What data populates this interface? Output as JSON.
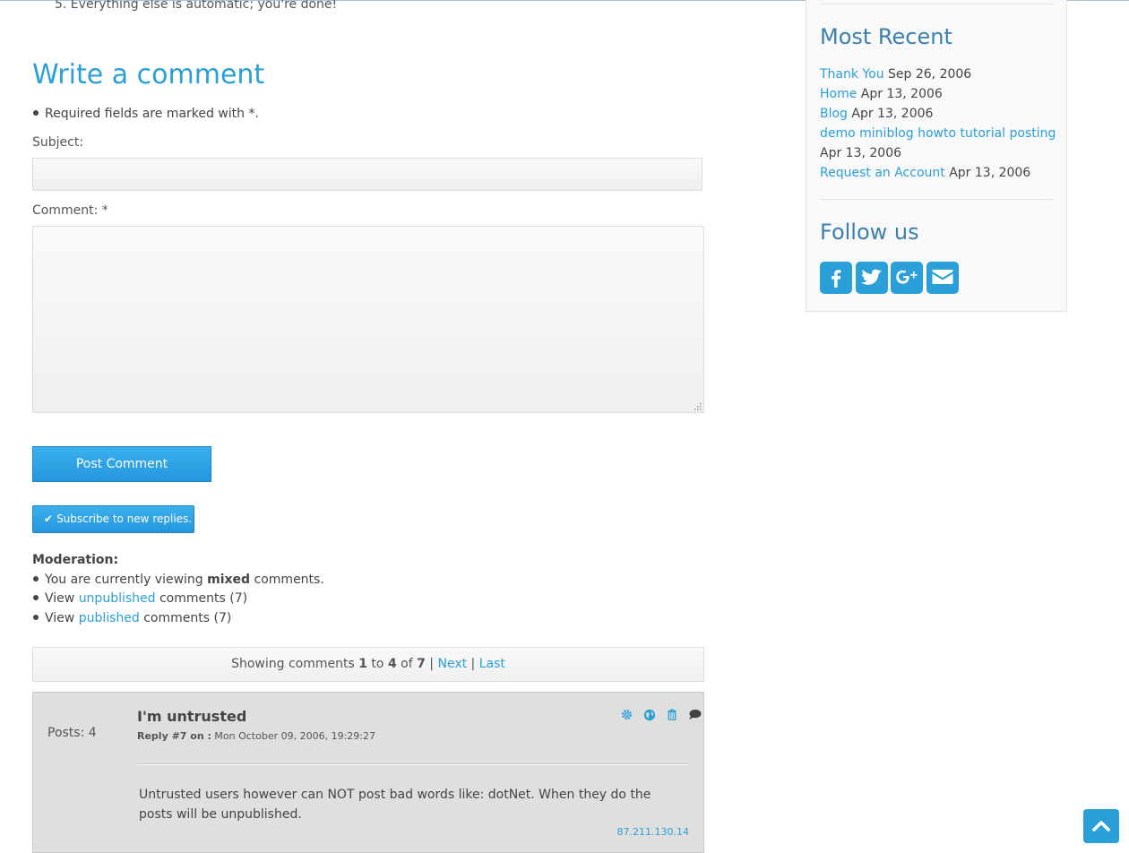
{
  "previous_step": "5. Everything else is automatic; you're done!",
  "comment_form": {
    "title": "Write a comment",
    "required_note": "Required fields are marked with *.",
    "subject_label": "Subject:",
    "subject_value": "",
    "comment_label": "Comment: *",
    "comment_value": "",
    "post_button": "Post Comment",
    "subscribe_button": "Subscribe to new replies."
  },
  "moderation": {
    "heading": "Moderation:",
    "line1_pre": "You are currently viewing ",
    "line1_bold": "mixed",
    "line1_post": " comments.",
    "line2_pre": "View ",
    "line2_link": "unpublished",
    "line2_post": " comments (7)",
    "line3_pre": "View ",
    "line3_link": "published",
    "line3_post": " comments (7)"
  },
  "pager": {
    "prefix": "Showing comments ",
    "from": "1",
    "to_word": " to ",
    "to": "4",
    "of_word": " of ",
    "total": "7",
    "sep": " | ",
    "next": "Next",
    "last": "Last"
  },
  "comment": {
    "posts": "Posts: 4",
    "title": "I'm untrusted",
    "reply_label": "Reply #7 on :",
    "date": " Mon October 09, 2006, 19:29:27",
    "body": "Untrusted users however can NOT post bad words like: dotNet. When they do the posts will be unpublished.",
    "ip": "87.211.130.14",
    "icons": [
      "gear-icon",
      "globe-icon",
      "trash-icon",
      "comment-icon"
    ]
  },
  "sidebar": {
    "recent_title": "Most Recent",
    "recent": [
      {
        "title": "Thank You",
        "date": "Sep 26, 2006"
      },
      {
        "title": "Home",
        "date": "Apr 13, 2006"
      },
      {
        "title": "Blog",
        "date": "Apr 13, 2006"
      },
      {
        "title": "demo miniblog howto tutorial posting",
        "date": "Apr 13, 2006"
      },
      {
        "title": "Request an Account",
        "date": "Apr 13, 2006"
      }
    ],
    "follow_title": "Follow us",
    "social": [
      "facebook-icon",
      "twitter-icon",
      "google-plus-icon",
      "envelope-icon"
    ]
  },
  "colors": {
    "accent": "#2a9fd8",
    "sidebar_heading": "#3a7fae",
    "comment_bg": "#dfdfdf"
  }
}
